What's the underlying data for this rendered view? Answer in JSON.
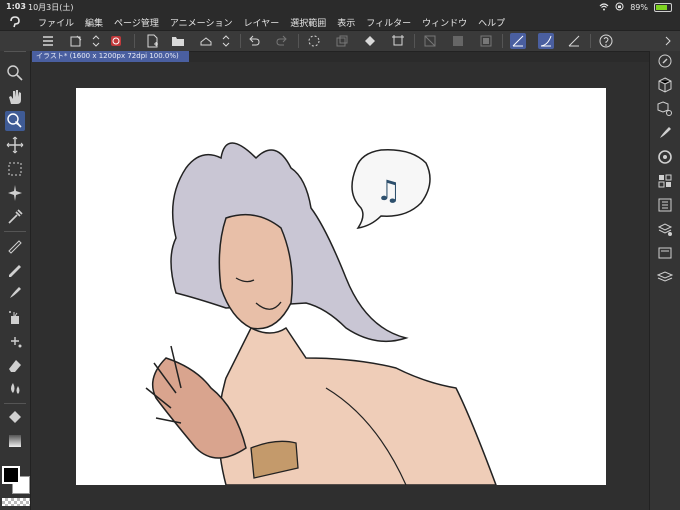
{
  "status": {
    "time": "1:03",
    "date": "10月3日(土)",
    "battery_pct": "89%",
    "battery_level": 0.89
  },
  "menu": {
    "items": [
      "ファイル",
      "編集",
      "ページ管理",
      "アニメーション",
      "レイヤー",
      "選択範囲",
      "表示",
      "フィルター",
      "ウィンドウ",
      "ヘルプ"
    ]
  },
  "document": {
    "tab_label": "イラスト* (1600 x 1200px 72dpi 100.0%)"
  },
  "colors": {
    "accent": "#4a5fa0",
    "main_color": "#000000",
    "sub_color": "#ffffff"
  },
  "toolbar_icons": [
    "menu-icon",
    "new-canvas-icon",
    "spinner-icon",
    "clip-studio-icon",
    "new-file-icon",
    "open-folder-icon",
    "save-icon",
    "undo-icon",
    "redo-icon",
    "loading-icon",
    "layer-copy-icon",
    "fill-icon",
    "transform-icon",
    "clear-selection-icon",
    "fill-selection-icon",
    "invert-selection-icon",
    "snap-to-ruler-icon",
    "snap-to-special-ruler-icon",
    "snap-to-grid-icon",
    "help-icon"
  ],
  "left_tools": [
    "zoom-icon",
    "hand-icon",
    "select-object-icon",
    "move-icon",
    "rect-select-icon",
    "auto-select-icon",
    "eyedropper-icon",
    "pen-icon",
    "pencil-icon",
    "brush-icon",
    "airbrush-icon",
    "decoration-icon",
    "eraser-icon",
    "blend-icon",
    "fill-icon",
    "gradient-icon"
  ],
  "right_tools": [
    "navigator-icon",
    "3d-material-icon",
    "object-icon",
    "sub-tool-icon",
    "color-wheel-icon",
    "color-set-icon",
    "history-icon",
    "layer-property-icon",
    "material-icon",
    "layer-icon"
  ]
}
